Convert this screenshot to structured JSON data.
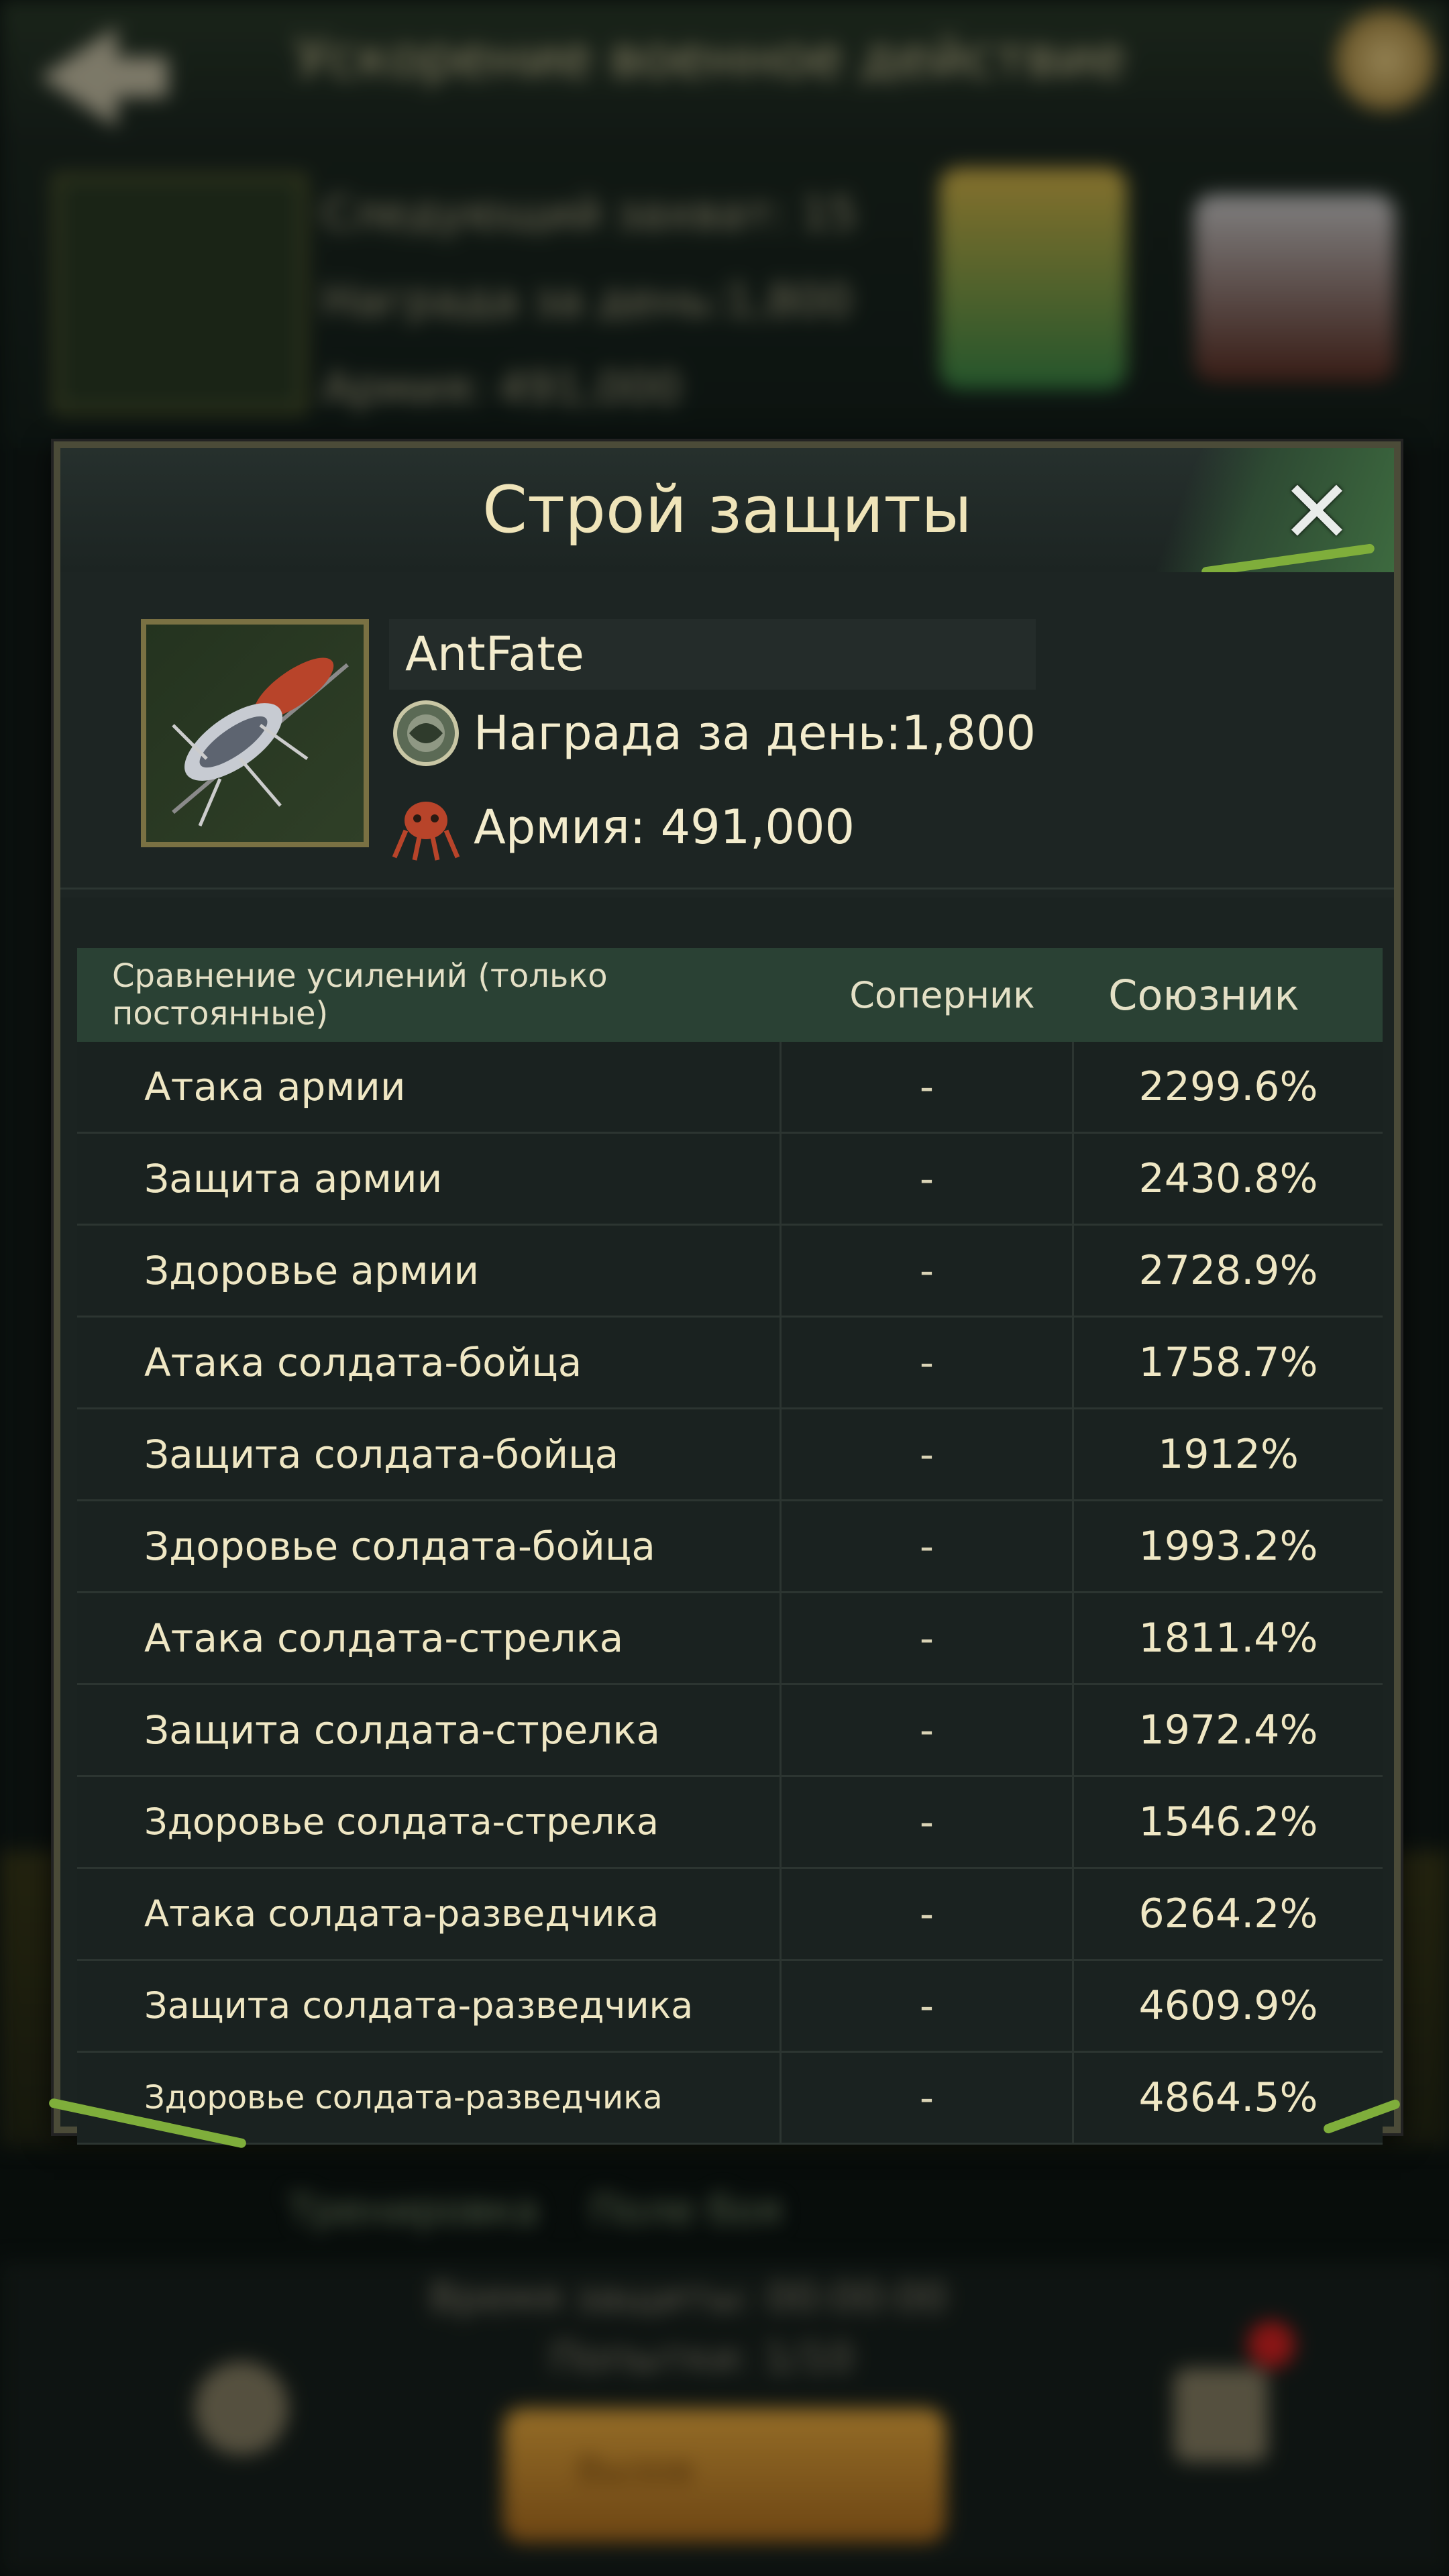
{
  "background": {
    "top_title": "Ускорение военное действие",
    "lines": [
      "Следующий захват: 15",
      "Награда за день:1,800",
      "Армия: 491,000"
    ],
    "tabs": [
      "Тренировка",
      "Поле боя"
    ],
    "info_lines": [
      "Время защиты: 00:00:00",
      "Попытки: 1/10"
    ],
    "button_label": "Вызов"
  },
  "dialog": {
    "title": "Строй защиты",
    "player": {
      "name": "AntFate",
      "reward_label": "Награда за день:1,800",
      "army_label": "Армия: 491,000"
    },
    "table": {
      "headers": {
        "boost": "Сравнение усилений (только постоянные)",
        "rival": "Соперник",
        "ally": "Союзник"
      },
      "rows": [
        {
          "name": "Атака армии",
          "rival": "-",
          "ally": "2299.6%"
        },
        {
          "name": "Защита армии",
          "rival": "-",
          "ally": "2430.8%"
        },
        {
          "name": "Здоровье армии",
          "rival": "-",
          "ally": "2728.9%"
        },
        {
          "name": "Атака солдата-бойца",
          "rival": "-",
          "ally": "1758.7%"
        },
        {
          "name": "Защита солдата-бойца",
          "rival": "-",
          "ally": "1912%"
        },
        {
          "name": "Здоровье солдата-бойца",
          "rival": "-",
          "ally": "1993.2%"
        },
        {
          "name": "Атака солдата-стрелка",
          "rival": "-",
          "ally": "1811.4%"
        },
        {
          "name": "Защита солдата-стрелка",
          "rival": "-",
          "ally": "1972.4%"
        },
        {
          "name": "Здоровье солдата-стрелка",
          "rival": "-",
          "ally": "1546.2%"
        },
        {
          "name": "Атака солдата-разведчика",
          "rival": "-",
          "ally": "6264.2%"
        },
        {
          "name": "Защита солдата-разведчика",
          "rival": "-",
          "ally": "4609.9%"
        },
        {
          "name": "Здоровье солдата-разведчика",
          "rival": "-",
          "ally": "4864.5%"
        }
      ]
    }
  },
  "icons": {
    "close": "close-icon",
    "reward": "reward-coin-icon",
    "army": "army-ant-icon",
    "portrait": "ant-portrait-icon"
  },
  "colors": {
    "header_green": "#2a4134",
    "title_text": "#efe4b9",
    "panel": "#1b2321"
  }
}
